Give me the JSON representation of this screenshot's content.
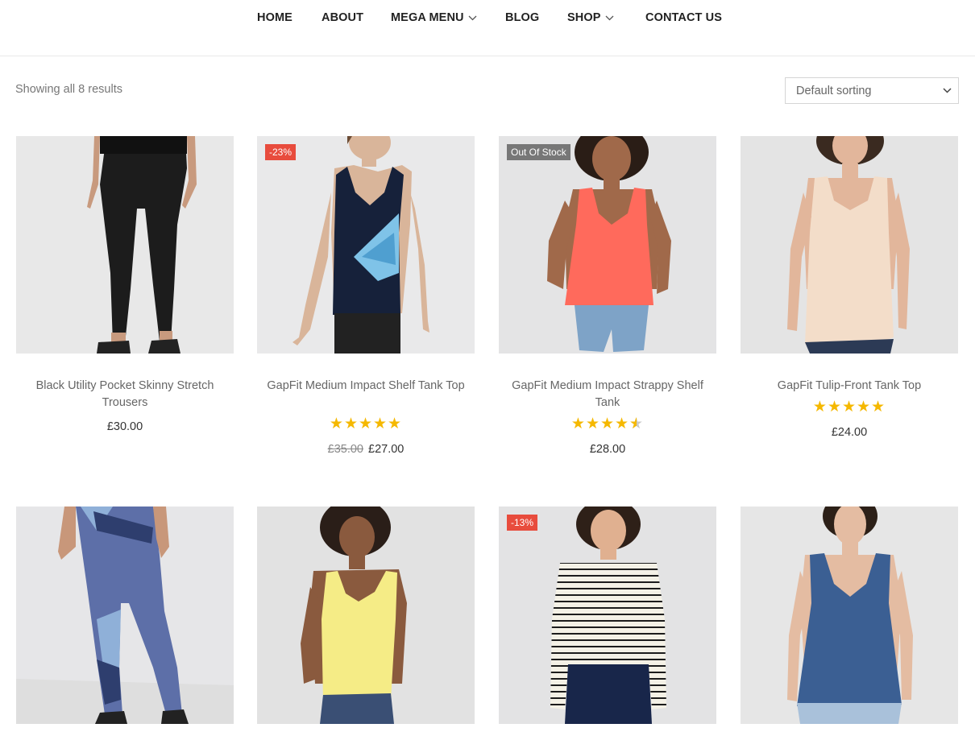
{
  "nav": {
    "items": [
      {
        "label": "HOME",
        "dropdown": false
      },
      {
        "label": "ABOUT",
        "dropdown": false
      },
      {
        "label": "MEGA MENU",
        "dropdown": true
      },
      {
        "label": "BLOG",
        "dropdown": false
      },
      {
        "label": "SHOP",
        "dropdown": true
      },
      {
        "label": "CONTACT US",
        "dropdown": false
      }
    ]
  },
  "toolbar": {
    "results_text": "Showing all 8 results",
    "sort_selected": "Default sorting"
  },
  "products": [
    {
      "title": "Black Utility Pocket Skinny Stretch Trousers",
      "price": "£30.00",
      "old_price": "",
      "badge": "",
      "rating": 0
    },
    {
      "title": "GapFit Medium Impact Shelf Tank Top",
      "price": "£27.00",
      "old_price": "£35.00",
      "badge": "-23%",
      "rating": 5
    },
    {
      "title": "GapFit Medium Impact Strappy Shelf Tank",
      "price": "£28.00",
      "old_price": "",
      "badge": "Out Of Stock",
      "rating": 4.5
    },
    {
      "title": "GapFit Tulip-Front Tank Top",
      "price": "£24.00",
      "old_price": "",
      "badge": "",
      "rating": 5
    },
    {
      "title": "",
      "price": "",
      "old_price": "",
      "badge": "",
      "rating": 0
    },
    {
      "title": "",
      "price": "",
      "old_price": "",
      "badge": "",
      "rating": 0
    },
    {
      "title": "",
      "price": "",
      "old_price": "",
      "badge": "-13%",
      "rating": 0
    },
    {
      "title": "",
      "price": "",
      "old_price": "",
      "badge": "",
      "rating": 0
    }
  ],
  "colors": {
    "star": "#f5b800",
    "sale_badge": "#e84c3d",
    "stock_badge": "#777777",
    "nav_text": "#222222"
  }
}
